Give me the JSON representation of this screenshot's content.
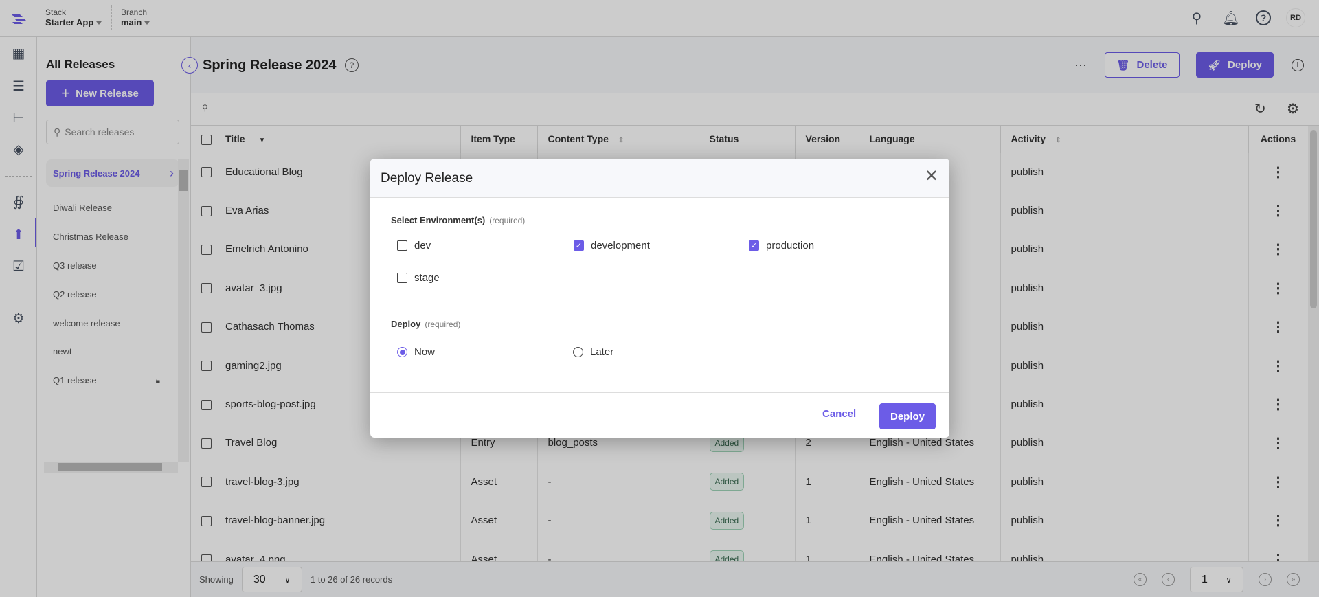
{
  "topbar": {
    "stack_label": "Stack",
    "stack_value": "Starter App",
    "branch_label": "Branch",
    "branch_value": "main",
    "avatar": "RD"
  },
  "rail_icons": [
    "dashboard-icon",
    "entries-icon",
    "content-models-icon",
    "assets-icon",
    "releases-network-icon",
    "deploy-icon",
    "tasks-icon",
    "settings-icon"
  ],
  "sidebar": {
    "title": "All Releases",
    "new_button": "New Release",
    "search_placeholder": "Search releases",
    "releases": [
      {
        "label": "Spring Release 2024",
        "selected": true
      },
      {
        "label": "Diwali Release"
      },
      {
        "label": "Christmas Release"
      },
      {
        "label": "Q3 release"
      },
      {
        "label": "Q2 release"
      },
      {
        "label": "welcome release"
      },
      {
        "label": "newt"
      },
      {
        "label": "Q1 release",
        "locked": true
      }
    ]
  },
  "header": {
    "title": "Spring Release 2024",
    "more": "···",
    "delete": "Delete",
    "deploy": "Deploy"
  },
  "table": {
    "columns": [
      "Title",
      "Item Type",
      "Content Type",
      "Status",
      "Version",
      "Language",
      "Activity",
      "Actions"
    ],
    "rows": [
      {
        "title": "Educational Blog",
        "item_type": "",
        "content_type": "",
        "status": "",
        "version": "",
        "language": "ited States",
        "activity": "publish"
      },
      {
        "title": "Eva Arias",
        "item_type": "",
        "content_type": "",
        "status": "",
        "version": "",
        "language": "ited States",
        "activity": "publish"
      },
      {
        "title": "Emelrich Antonino",
        "item_type": "",
        "content_type": "",
        "status": "",
        "version": "",
        "language": "ited States",
        "activity": "publish"
      },
      {
        "title": "avatar_3.jpg",
        "item_type": "",
        "content_type": "",
        "status": "",
        "version": "",
        "language": "ited States",
        "activity": "publish"
      },
      {
        "title": "Cathasach Thomas",
        "item_type": "",
        "content_type": "",
        "status": "",
        "version": "",
        "language": "ited States",
        "activity": "publish"
      },
      {
        "title": "gaming2.jpg",
        "item_type": "",
        "content_type": "",
        "status": "",
        "version": "",
        "language": "ited States",
        "activity": "publish"
      },
      {
        "title": "sports-blog-post.jpg",
        "item_type": "",
        "content_type": "",
        "status": "",
        "version": "",
        "language": "ited States",
        "activity": "publish"
      },
      {
        "title": "Travel Blog",
        "item_type": "Entry",
        "content_type": "blog_posts",
        "status": "Added",
        "version": "2",
        "language": "English - United States",
        "activity": "publish"
      },
      {
        "title": "travel-blog-3.jpg",
        "item_type": "Asset",
        "content_type": "-",
        "status": "Added",
        "version": "1",
        "language": "English - United States",
        "activity": "publish"
      },
      {
        "title": "travel-blog-banner.jpg",
        "item_type": "Asset",
        "content_type": "-",
        "status": "Added",
        "version": "1",
        "language": "English - United States",
        "activity": "publish"
      },
      {
        "title": "avatar_4.png",
        "item_type": "Asset",
        "content_type": "-",
        "status": "Added",
        "version": "1",
        "language": "English - United States",
        "activity": "publish"
      }
    ]
  },
  "footer": {
    "showing": "Showing",
    "per_page": "30",
    "records": "1 to 26 of 26 records",
    "page": "1"
  },
  "modal": {
    "title": "Deploy Release",
    "env_label": "Select Environment(s)",
    "required": "(required)",
    "environments": [
      {
        "label": "dev",
        "checked": false
      },
      {
        "label": "development",
        "checked": true
      },
      {
        "label": "production",
        "checked": true
      },
      {
        "label": "stage",
        "checked": false
      }
    ],
    "deploy_label": "Deploy",
    "deploy_options": [
      {
        "label": "Now",
        "selected": true
      },
      {
        "label": "Later",
        "selected": false
      }
    ],
    "cancel": "Cancel",
    "submit": "Deploy"
  },
  "colors": {
    "accent": "#6c5ce7",
    "badge_bg": "#eaf7f0"
  }
}
